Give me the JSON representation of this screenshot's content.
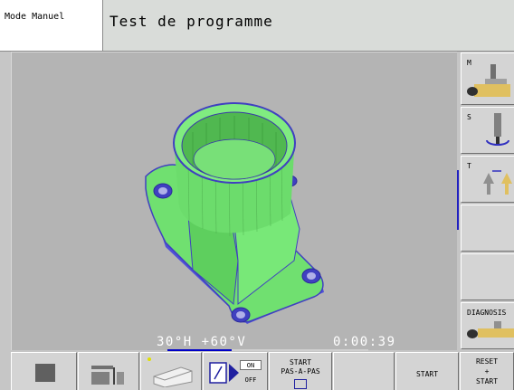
{
  "header": {
    "mode_label": "Mode Manuel",
    "program_title": "Test de programme"
  },
  "viewport": {
    "view_angles": "30°H +60°V",
    "elapsed_time": "0:00:39",
    "progress_fraction": 0.32,
    "part_color": "#70e070",
    "part_edge_color": "#5050d8"
  },
  "side_softkeys": [
    {
      "label": "M",
      "icon": "spindle-function-icon"
    },
    {
      "label": "S",
      "icon": "spindle-speed-icon"
    },
    {
      "label": "T",
      "icon": "tool-call-icon"
    },
    {
      "label": "",
      "icon": ""
    },
    {
      "label": "",
      "icon": ""
    },
    {
      "label": "DIAGNOSIS",
      "icon": "diagnosis-icon"
    }
  ],
  "bottom_softkeys": {
    "stop": {
      "icon": "stop-square-icon"
    },
    "plan_view": {
      "icon": "plan-view-icon"
    },
    "view_3d": {
      "icon": "view-3d-icon"
    },
    "block_skip": {
      "icon": "block-skip-icon",
      "on_label": "ON",
      "off_label": "OFF"
    },
    "single_step": {
      "line1": "START",
      "line2": "PAS-A-PAS"
    },
    "blank": {},
    "start": {
      "label": "START"
    },
    "reset_start": {
      "line1": "RESET",
      "line2": "+",
      "line3": "START"
    }
  }
}
